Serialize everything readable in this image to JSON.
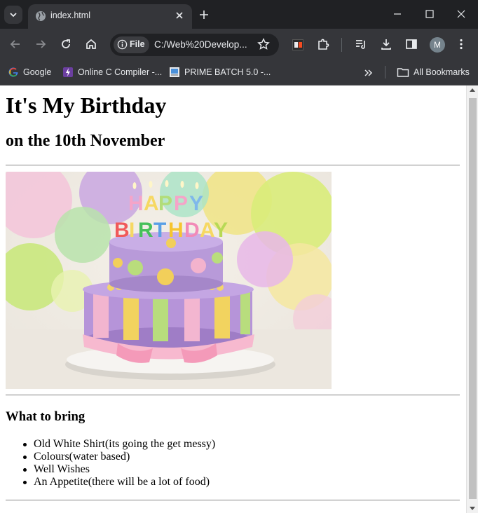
{
  "browser": {
    "tab": {
      "title": "index.html"
    },
    "omnibox": {
      "chip_label": "File",
      "url": "C:/Web%20Develop..."
    },
    "avatar_letter": "M",
    "bookmarks": [
      {
        "label": "Google",
        "icon": "google-icon"
      },
      {
        "label": "Online C Compiler -...",
        "icon": "compiler-icon"
      },
      {
        "label": "PRIME BATCH 5.0 -...",
        "icon": "doc-icon"
      }
    ],
    "all_bookmarks_label": "All Bookmarks"
  },
  "page": {
    "heading": "It's My Birthday",
    "subheading": "on the 10th November",
    "image_alt": "birthday cake",
    "section_heading": "What to bring",
    "items": [
      "Old White Shirt(its going the get messy)",
      "Colours(water based)",
      "Well Wishes",
      "An Appetite(there will be a lot of food)"
    ]
  },
  "colors": {
    "chrome_dark": "#202124",
    "chrome_toolbar": "#35363a",
    "page_bg": "#ffffff"
  }
}
